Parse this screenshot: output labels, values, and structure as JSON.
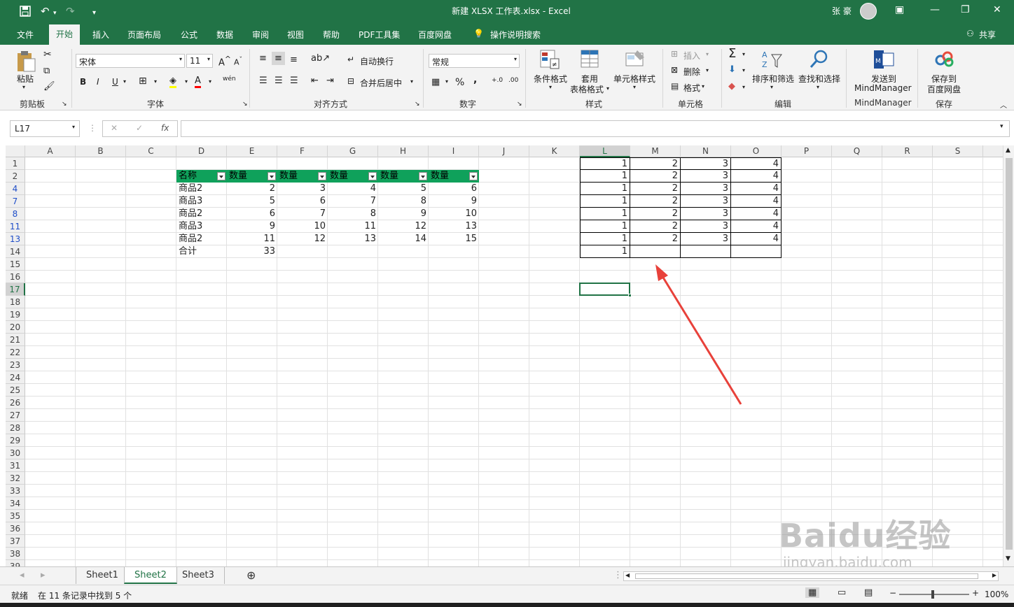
{
  "titlebar": {
    "title": "新建 XLSX 工作表.xlsx  -  Excel",
    "user": "张 豪",
    "save_icon": "save-icon",
    "undo_icon": "undo-icon",
    "redo_icon": "redo-icon"
  },
  "menu": {
    "items": [
      "文件",
      "开始",
      "插入",
      "页面布局",
      "公式",
      "数据",
      "审阅",
      "视图",
      "帮助",
      "PDF工具集",
      "百度网盘",
      "操作说明搜索"
    ],
    "active": "开始",
    "share": "共享"
  },
  "ribbon": {
    "clipboard": {
      "paste": "粘贴",
      "group": "剪贴板"
    },
    "font": {
      "name": "宋体",
      "size": "11",
      "group": "字体",
      "bold": "B",
      "italic": "I",
      "underline": "U",
      "pinyin": "wén"
    },
    "alignment": {
      "wrap": "自动换行",
      "merge": "合并后居中",
      "group": "对齐方式"
    },
    "number": {
      "format": "常规",
      "percent": "%",
      "comma": ",",
      "group": "数字"
    },
    "styles": {
      "conditional": "条件格式",
      "table_line1": "套用",
      "table_line2": "表格格式",
      "cell_styles": "单元格样式",
      "group": "样式"
    },
    "cells": {
      "insert": "插入",
      "delete": "删除",
      "format": "格式",
      "group": "单元格"
    },
    "editing": {
      "sort": "排序和筛选",
      "find": "查找和选择",
      "group": "编辑"
    },
    "mindmanager": {
      "line1": "发送到",
      "line2": "MindManager",
      "group": "MindManager"
    },
    "save": {
      "line1": "保存到",
      "line2": "百度网盘",
      "group": "保存"
    }
  },
  "formula_bar": {
    "name_box": "L17",
    "fx": "fx",
    "value": ""
  },
  "columns": [
    "A",
    "B",
    "C",
    "D",
    "E",
    "F",
    "G",
    "H",
    "I",
    "J",
    "K",
    "L",
    "M",
    "N",
    "O",
    "P",
    "Q",
    "R",
    "S"
  ],
  "rows": [
    "1",
    "2",
    "4",
    "7",
    "8",
    "11",
    "13",
    "14",
    "15",
    "16",
    "17",
    "18",
    "19",
    "20",
    "21",
    "22",
    "23",
    "24",
    "25",
    "26",
    "27",
    "28",
    "29",
    "30",
    "31",
    "32",
    "33",
    "34",
    "35",
    "36",
    "37",
    "38",
    "39"
  ],
  "filtered_rows": [
    "4",
    "7",
    "8",
    "11",
    "13"
  ],
  "table": {
    "headers": [
      "名称",
      "数量",
      "数量",
      "数量",
      "数量",
      "数量"
    ],
    "rows": [
      [
        "商品2",
        "2",
        "3",
        "4",
        "5",
        "6"
      ],
      [
        "商品3",
        "5",
        "6",
        "7",
        "8",
        "9"
      ],
      [
        "商品2",
        "6",
        "7",
        "8",
        "9",
        "10"
      ],
      [
        "商品3",
        "9",
        "10",
        "11",
        "12",
        "13"
      ],
      [
        "商品2",
        "11",
        "12",
        "13",
        "14",
        "15"
      ]
    ],
    "total_label": "合计",
    "total_value": "33"
  },
  "right_table": {
    "rows": [
      [
        "1",
        "2",
        "3",
        "4"
      ],
      [
        "1",
        "2",
        "3",
        "4"
      ],
      [
        "1",
        "2",
        "3",
        "4"
      ],
      [
        "1",
        "2",
        "3",
        "4"
      ],
      [
        "1",
        "2",
        "3",
        "4"
      ],
      [
        "1",
        "2",
        "3",
        "4"
      ],
      [
        "1",
        "2",
        "3",
        "4"
      ],
      [
        "1",
        "",
        "",
        ""
      ]
    ]
  },
  "sheets": [
    "Sheet1",
    "Sheet2",
    "Sheet3"
  ],
  "active_sheet": "Sheet2",
  "status": {
    "mode": "就绪",
    "message": "在 11 条记录中找到 5 个",
    "zoom": "100%"
  },
  "watermark": {
    "brand": "Baidu经验",
    "url": "jingyan.baidu.com"
  },
  "colors": {
    "excel_green": "#217346",
    "header_fill": "#0fa15b",
    "arrow": "#e8413a"
  }
}
